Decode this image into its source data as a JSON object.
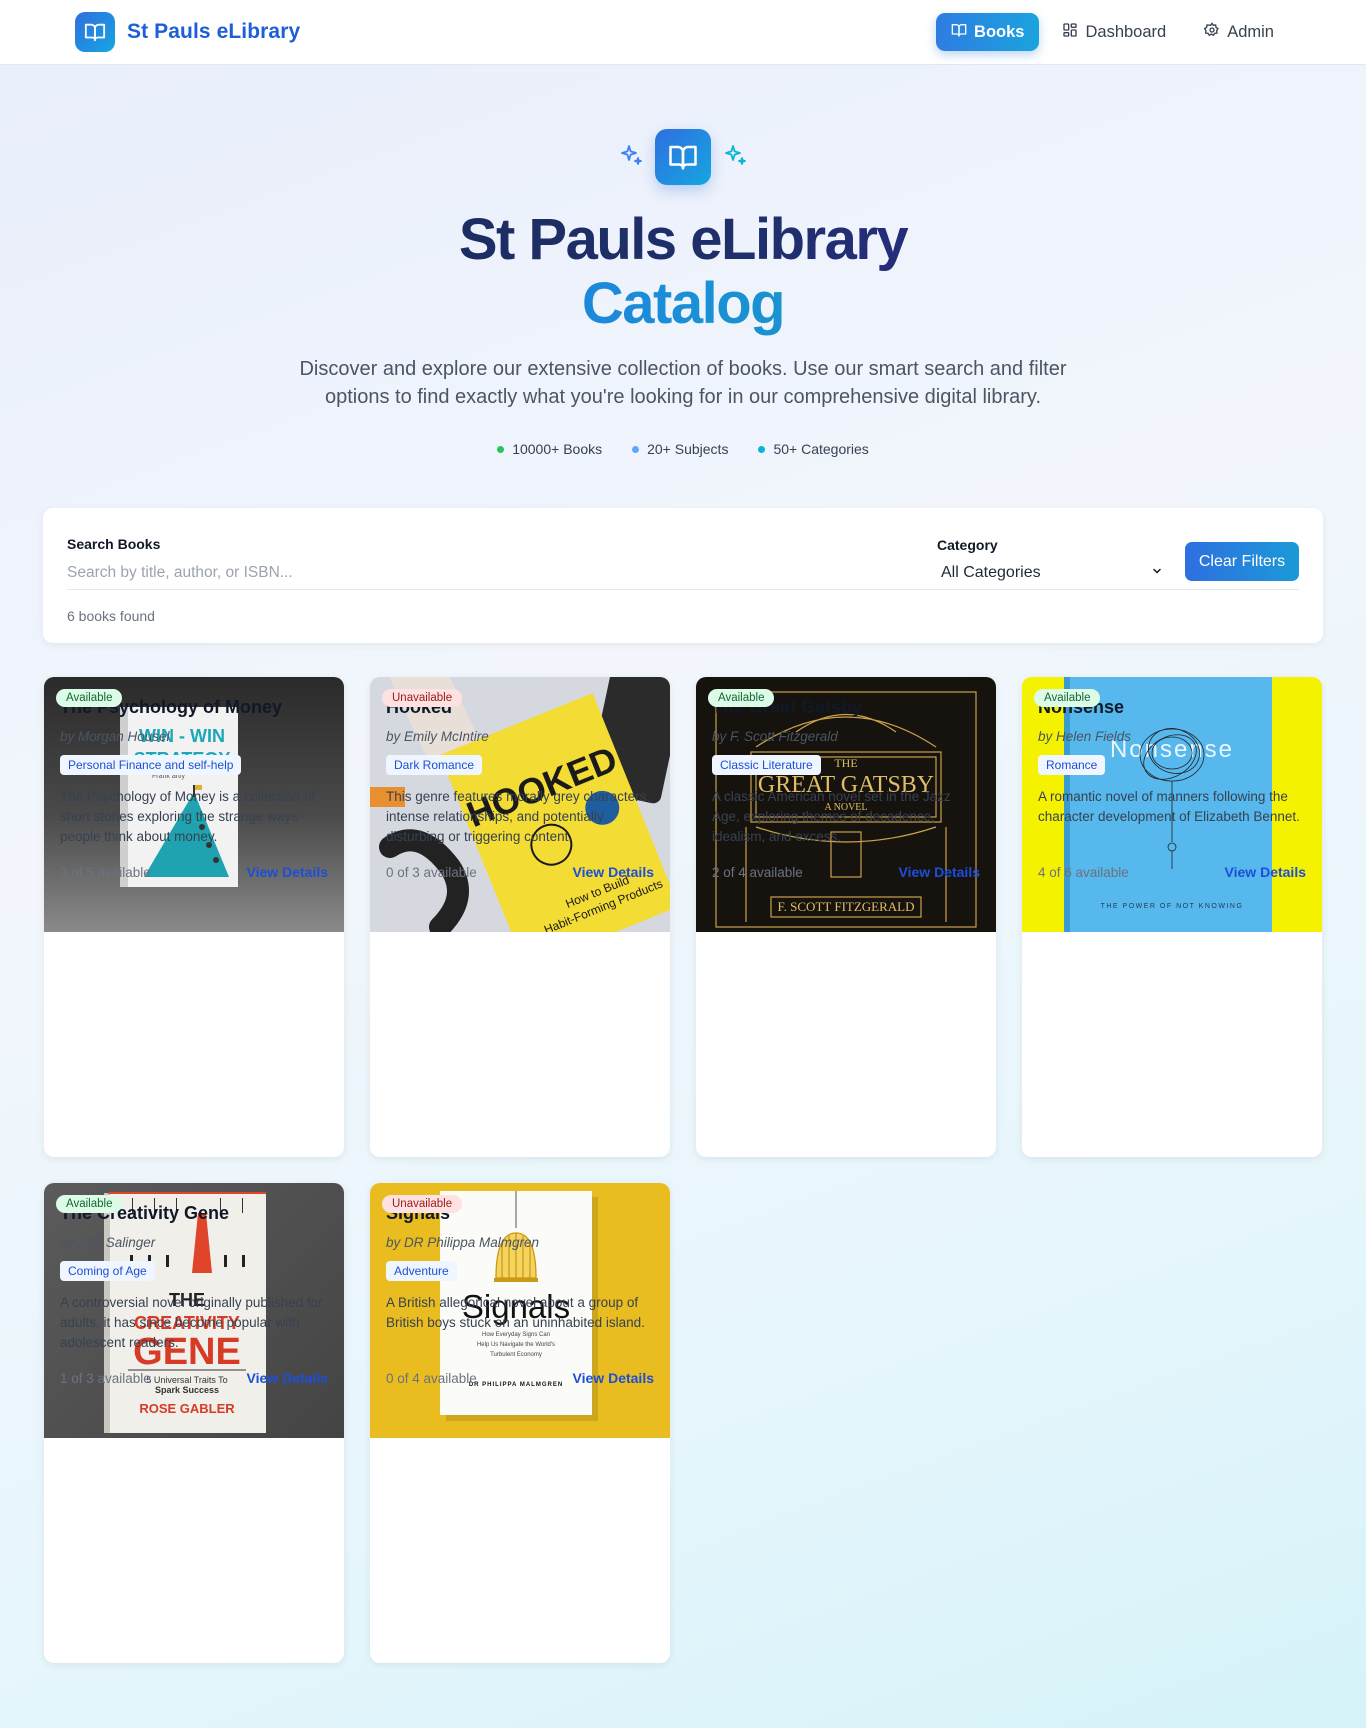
{
  "nav": {
    "brand": "St Pauls eLibrary",
    "items": [
      {
        "label": "Books",
        "icon": "book-open-icon",
        "active": true
      },
      {
        "label": "Dashboard",
        "icon": "grid-icon",
        "active": false
      },
      {
        "label": "Admin",
        "icon": "gear-icon",
        "active": false
      }
    ]
  },
  "hero": {
    "title_line1": "St Pauls eLibrary",
    "title_line2": "Catalog",
    "description": "Discover and explore our extensive collection of books. Use our smart search and filter options to find exactly what you're looking for in our comprehensive digital library.",
    "stats": [
      {
        "label": "10000+ Books",
        "color": "#22c55e"
      },
      {
        "label": "20+ Subjects",
        "color": "#60a5fa"
      },
      {
        "label": "50+ Categories",
        "color": "#06b6d4"
      }
    ]
  },
  "filters": {
    "search_label": "Search Books",
    "search_placeholder": "Search by title, author, or ISBN...",
    "search_value": "",
    "category_label": "Category",
    "category_value": "All Categories",
    "clear_label": "Clear Filters",
    "result_count": "6 books found"
  },
  "books": [
    {
      "title": "The Psychology of Money",
      "author": "by Morgan Housel",
      "genre": "Personal Finance and self-help",
      "description": "The Psychology of Money is a collection of short stories exploring the strange ways people think about money.",
      "availability": "3 of 5 available",
      "status": "Available",
      "action": "View Details",
      "cover": {
        "title": "WIN - WIN STRATEGY",
        "subtitle": "Frank artly"
      }
    },
    {
      "title": "Hooked",
      "author": "by Emily McIntire",
      "genre": "Dark Romance",
      "description": "This genre features morally grey characters, intense relationships, and potentially disturbing or triggering content.",
      "availability": "0 of 3 available",
      "status": "Unavailable",
      "action": "View Details",
      "cover": {
        "title": "HOOKED",
        "subtitle": "How to Build Habit-Forming Products"
      }
    },
    {
      "title": "The Great Gatsby",
      "author": "by F. Scott Fitzgerald",
      "genre": "Classic Literature",
      "description": "A classic American novel set in the Jazz Age, exploring themes of decadence, idealism, and excess.",
      "availability": "2 of 4 available",
      "status": "Available",
      "action": "View Details",
      "cover": {
        "title": "GREAT GATSBY",
        "subtitle": "F. SCOTT FITZGERALD"
      }
    },
    {
      "title": "Nonsense",
      "author": "by Helen Fields",
      "genre": "Romance",
      "description": "A romantic novel of manners following the character development of Elizabeth Bennet.",
      "availability": "4 of 6 available",
      "status": "Available",
      "action": "View Details",
      "cover": {
        "title": "Nonsense",
        "subtitle": "THE POWER OF NOT KNOWING"
      }
    },
    {
      "title": "The Creativity Gene",
      "author": "by J.D. Salinger",
      "genre": "Coming of Age",
      "description": "A controversial novel originally published for adults, it has since become popular with adolescent readers.",
      "availability": "1 of 3 available",
      "status": "Available",
      "action": "View Details",
      "cover": {
        "title": "GENE",
        "subtitle": "ROSE GABLER"
      }
    },
    {
      "title": "Signals",
      "author": "by DR Philippa Malmgren",
      "genre": "Adventure",
      "description": "A British allegorical novel about a group of British boys stuck on an uninhabited island.",
      "availability": "0 of 4 available",
      "status": "Unavailable",
      "action": "View Details",
      "cover": {
        "title": "Signals",
        "subtitle": "DR PHILIPPA MALMGREN"
      }
    }
  ]
}
